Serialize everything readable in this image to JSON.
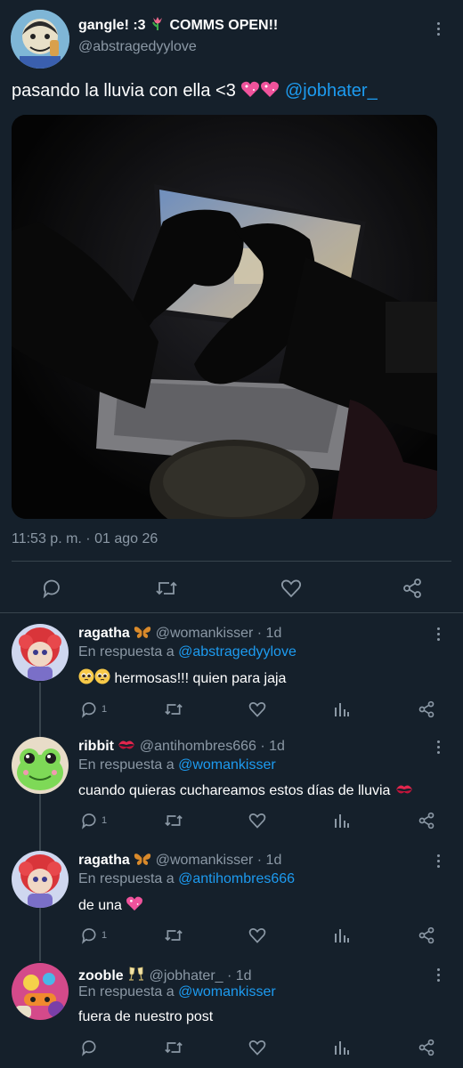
{
  "post": {
    "display_name": "gangle! :3",
    "name_suffix": "COMMS OPEN!!",
    "handle": "@abstragedyylove",
    "text": "pasando la lluvia con ella <3",
    "mention": "@jobhater_",
    "timestamp": "11:53 p. m. · 01 ago 26",
    "actions": [
      "reply-icon",
      "retweet-icon",
      "like-icon",
      "share-icon"
    ]
  },
  "replies": [
    {
      "name": "ragatha",
      "handle": "@womankisser",
      "time": "· 1d",
      "in_reply_prefix": "En respuesta a",
      "in_reply_to": "@abstragedyylove",
      "text": "hermosas!!! quien para jaja",
      "reply_count": "1"
    },
    {
      "name": "ribbit",
      "handle": "@antihombres666",
      "time": "· 1d",
      "in_reply_prefix": "En respuesta a",
      "in_reply_to": "@womankisser",
      "text": "cuando quieras cuchareamos estos días de lluvia",
      "reply_count": "1"
    },
    {
      "name": "ragatha",
      "handle": "@womankisser",
      "time": "· 1d",
      "in_reply_prefix": "En respuesta a",
      "in_reply_to": "@antihombres666",
      "text": "de una",
      "reply_count": "1"
    },
    {
      "name": "zooble",
      "handle": "@jobhater_",
      "time": "· 1d",
      "in_reply_prefix": "En respuesta a",
      "in_reply_to": "@womankisser",
      "text": "fuera de nuestro post",
      "reply_count": ""
    }
  ],
  "colors": {
    "background": "#15202b",
    "accent": "#1d9bf0",
    "muted": "#8b98a5",
    "divider": "#38444d"
  }
}
